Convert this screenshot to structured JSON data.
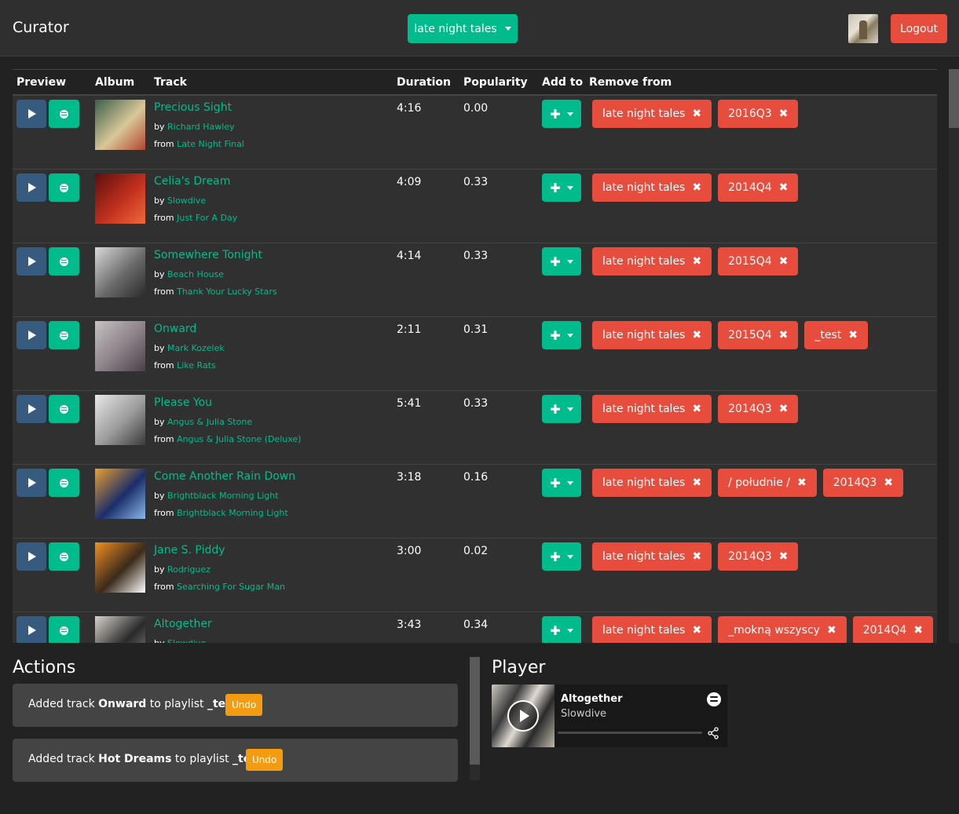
{
  "navbar": {
    "brand": "Curator",
    "playlist_selected": "late night tales",
    "logout_label": "Logout"
  },
  "table": {
    "headers": {
      "preview": "Preview",
      "album": "Album",
      "track": "Track",
      "duration": "Duration",
      "popularity": "Popularity",
      "add_to": "Add to",
      "remove_from": "Remove from"
    },
    "by_label": "by",
    "from_label": "from",
    "rows": [
      {
        "track": "Precious Sight",
        "artist": "Richard Hawley",
        "album": "Late Night Final",
        "duration": "4:16",
        "popularity": "0.00",
        "tags": [
          "late night tales",
          "2016Q3"
        ],
        "art_colors": [
          "#3b5f4a",
          "#d8c79a",
          "#b0472f"
        ]
      },
      {
        "track": "Celia's Dream",
        "artist": "Slowdive",
        "album": "Just For A Day",
        "duration": "4:09",
        "popularity": "0.33",
        "tags": [
          "late night tales",
          "2014Q4"
        ],
        "art_colors": [
          "#5a1010",
          "#c2301e",
          "#f06a3a"
        ]
      },
      {
        "track": "Somewhere Tonight",
        "artist": "Beach House",
        "album": "Thank Your Lucky Stars",
        "duration": "4:14",
        "popularity": "0.33",
        "tags": [
          "late night tales",
          "2015Q4"
        ],
        "art_colors": [
          "#d9d9d9",
          "#6a6a6a",
          "#2a2a2a"
        ]
      },
      {
        "track": "Onward",
        "artist": "Mark Kozelek",
        "album": "Like Rats",
        "duration": "2:11",
        "popularity": "0.31",
        "tags": [
          "late night tales",
          "2015Q4",
          "_test"
        ],
        "art_colors": [
          "#c6c2c4",
          "#8a7f86",
          "#4a3f46"
        ]
      },
      {
        "track": "Please You",
        "artist": "Angus & Julia Stone",
        "album": "Angus & Julia Stone (Deluxe)",
        "duration": "5:41",
        "popularity": "0.33",
        "tags": [
          "late night tales",
          "2014Q3"
        ],
        "art_colors": [
          "#e8e8e8",
          "#9a9a9a",
          "#3a3a3a"
        ]
      },
      {
        "track": "Come Another Rain Down",
        "artist": "Brightblack Morning Light",
        "album": "Brightblack Morning Light",
        "duration": "3:18",
        "popularity": "0.16",
        "tags": [
          "late night tales",
          "/ południe /",
          "2014Q3"
        ],
        "art_colors": [
          "#e8a030",
          "#1a2e6a",
          "#8ab8e8"
        ]
      },
      {
        "track": "Jane S. Piddy",
        "artist": "Rodriguez",
        "album": "Searching For Sugar Man",
        "duration": "3:00",
        "popularity": "0.02",
        "tags": [
          "late night tales",
          "2014Q3"
        ],
        "art_colors": [
          "#f09020",
          "#3a2a1a",
          "#ffffff"
        ]
      },
      {
        "track": "Altogether",
        "artist": "Slowdive",
        "album": "",
        "duration": "3:43",
        "popularity": "0.34",
        "tags": [
          "late night tales",
          "_mokną wszyscy",
          "2014Q4"
        ],
        "art_colors": [
          "#d8d2ca",
          "#2a2a2a",
          "#8a8a8a"
        ]
      }
    ]
  },
  "actions": {
    "title": "Actions",
    "items": [
      {
        "prefix": "Added track ",
        "track": "Onward",
        "middle": " to playlist ",
        "playlist": "_test",
        "undo_label": "Undo"
      },
      {
        "prefix": "Added track ",
        "track": "Hot Dreams",
        "middle": " to playlist ",
        "playlist": "_test",
        "undo_label": "Undo"
      }
    ]
  },
  "player": {
    "title": "Player",
    "track": "Altogether",
    "artist": "Slowdive"
  },
  "colors": {
    "accent": "#00bc8c",
    "danger": "#e74c3c",
    "primary": "#375a7f",
    "warning": "#f39c12"
  }
}
